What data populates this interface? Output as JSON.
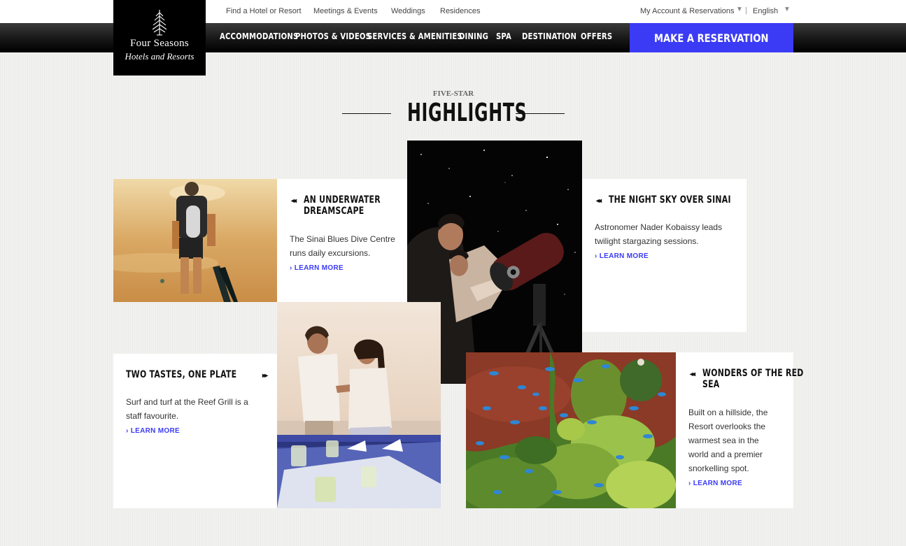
{
  "utility_nav": {
    "find_hotel": "Find a Hotel or Resort",
    "meetings": "Meetings & Events",
    "weddings": "Weddings",
    "residences": "Residences",
    "account": "My Account & Reservations",
    "language": "English",
    "separator": "|",
    "caret": "▼"
  },
  "logo": {
    "line1": "Four Seasons",
    "line2": "Hotels and Resorts"
  },
  "main_nav": {
    "items": [
      "ACCOMMODATIONS",
      "PHOTOS & VIDEOS",
      "SERVICES & AMENITIES",
      "DINING",
      "SPA",
      "DESTINATION",
      "OFFERS"
    ],
    "cta": "MAKE A RESERVATION"
  },
  "section": {
    "eyebrow": "FIVE-STAR",
    "title": "HIGHLIGHTS"
  },
  "tiles": [
    {
      "title_line1": "AN UNDERWATER",
      "title_line2": "DREAMSCAPE",
      "text_line1": "The Sinai Blues Dive Centre",
      "text_line2": "runs daily excursions.",
      "link": "› LEARN MORE",
      "arrow": "◂◂"
    },
    {
      "title_line1": "THE NIGHT SKY OVER SINAI",
      "text_line1": "Astronomer Nader Kobaissy leads",
      "text_line2": "twilight stargazing sessions.",
      "link": "› LEARN MORE",
      "arrow": "◂◂"
    },
    {
      "title_line1": "TWO TASTES, ONE PLATE",
      "text_line1": "Surf and turf at the Reef Grill is a",
      "text_line2": "staff favourite.",
      "link": "› LEARN MORE",
      "arrow": "▸▸"
    },
    {
      "title_line1": "WONDERS OF THE RED",
      "title_line2": "SEA",
      "text_line1": "Built on a hillside, the",
      "text_line2": "Resort overlooks the",
      "text_line3": "warmest sea in the",
      "text_line4": "world and a premier",
      "text_line5": "snorkelling spot.",
      "link": "› LEARN MORE",
      "arrow": "◂◂"
    }
  ],
  "colors": {
    "accent_blue": "#3b3bf5",
    "nav_black": "#111111",
    "page_bg": "#f1f1ef"
  },
  "icons": [
    "four-seasons-tree-logo-icon",
    "chevron-down-icon",
    "double-arrow-left-icon",
    "double-arrow-right-icon"
  ]
}
